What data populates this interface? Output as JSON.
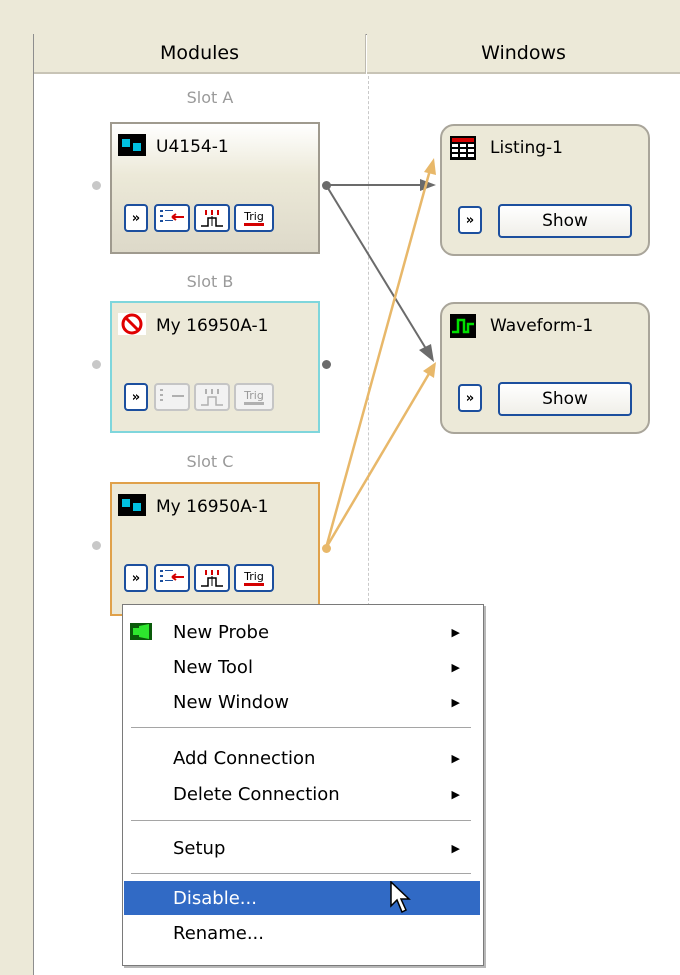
{
  "columns": {
    "modules": "Modules",
    "windows": "Windows"
  },
  "slots": [
    {
      "label": "Slot A",
      "module": "U4154-1",
      "trig": "Trig"
    },
    {
      "label": "Slot B",
      "module": "My 16950A-1",
      "trig": "Trig"
    },
    {
      "label": "Slot C",
      "module": "My 16950A-1",
      "trig": "Trig"
    }
  ],
  "windows": [
    {
      "title": "Listing-1",
      "show": "Show"
    },
    {
      "title": "Waveform-1",
      "show": "Show"
    }
  ],
  "menu": {
    "items": [
      {
        "label": "New Probe",
        "submenu": true
      },
      {
        "label": "New Tool",
        "submenu": true
      },
      {
        "label": "New Window",
        "submenu": true
      },
      {
        "label": "Add Connection",
        "submenu": true
      },
      {
        "label": "Delete Connection",
        "submenu": true
      },
      {
        "label": "Setup",
        "submenu": true
      },
      {
        "label": "Disable...",
        "submenu": false,
        "highlighted": true
      },
      {
        "label": "Rename...",
        "submenu": false
      }
    ]
  },
  "colors": {
    "highlight": "#316ac5",
    "connection_gray": "#6b6b6b",
    "connection_orange": "#e8b86a",
    "disabled_border": "#7fd6dc",
    "selected_border": "#e0a14a"
  }
}
